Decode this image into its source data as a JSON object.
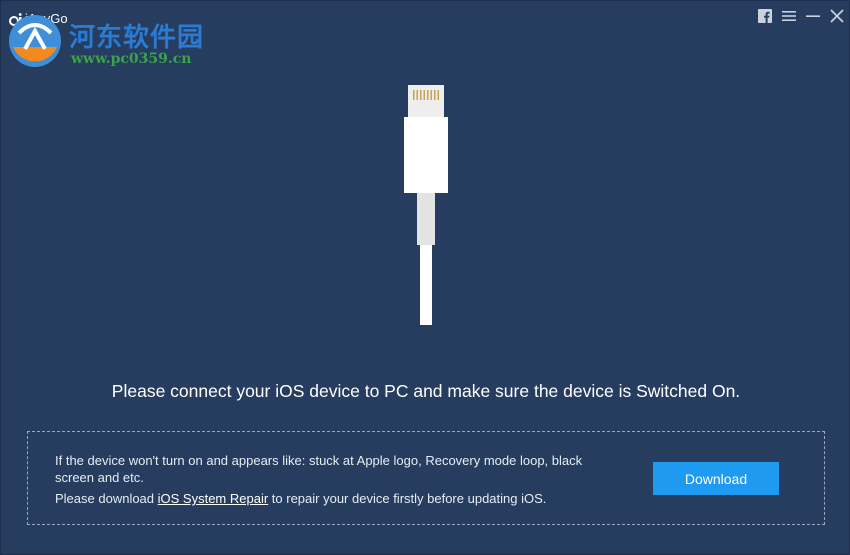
{
  "window": {
    "title": "iAnyGo",
    "controls": [
      "facebook-icon",
      "menu-icon",
      "minimize-icon",
      "close-icon"
    ]
  },
  "watermark": {
    "title": "河东软件园",
    "url": "www.pc0359.cn"
  },
  "main": {
    "message": "Please connect your iOS device to PC and make sure the device is Switched On."
  },
  "info_box": {
    "line1": "If the device won't turn on and appears like: stuck at Apple logo, Recovery mode loop, black screen and etc.",
    "line2_prefix": "Please download ",
    "line2_link": "iOS System Repair",
    "line2_suffix": " to repair your device firstly before updating iOS.",
    "download_label": "Download"
  },
  "colors": {
    "background": "#263d60",
    "button": "#1e9af0",
    "watermark_title": "#2b7bd3",
    "watermark_url": "#3aa24a"
  }
}
